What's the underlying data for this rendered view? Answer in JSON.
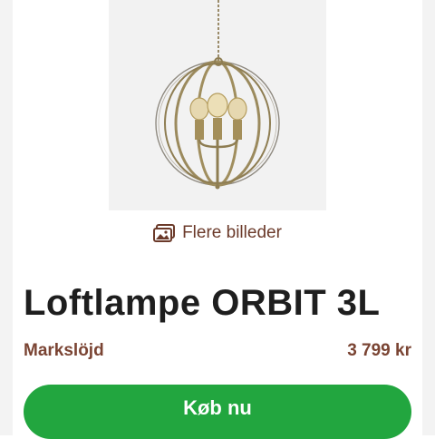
{
  "gallery": {
    "more_images_label": "Flere billeder",
    "icon": "images-icon"
  },
  "product": {
    "title": "Loftlampe ORBIT 3L",
    "brand": "Markslöjd",
    "price": "3 799 kr"
  },
  "actions": {
    "buy_label": "Køb nu"
  },
  "colors": {
    "accent": "#22a63f",
    "brand_text": "#7a4433",
    "title_text": "#1e1e1e",
    "image_bg": "#f2f2f2"
  }
}
